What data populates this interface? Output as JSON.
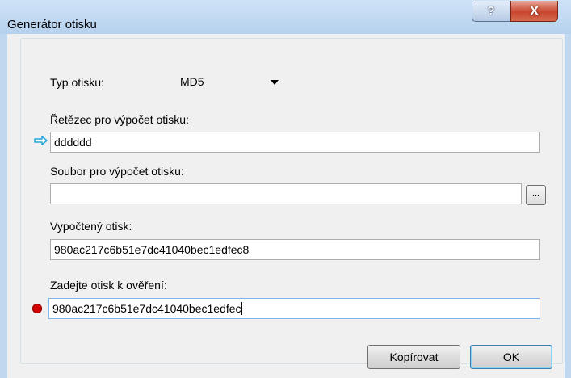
{
  "window": {
    "title": "Generátor otisku",
    "help_label": "?",
    "close_label": "X"
  },
  "form": {
    "hash_type_label": "Typ otisku:",
    "hash_type_value": "MD5",
    "string_label": "Řetězec pro výpočet otisku:",
    "string_value": "dddddd",
    "file_label": "Soubor pro výpočet otisku:",
    "file_value": "",
    "browse_label": "...",
    "computed_label": "Vypočtený otisk:",
    "computed_value": "980ac217c6b51e7dc41040bec1edfec8",
    "verify_label": "Zadejte otisk k ověření:",
    "verify_value": "980ac217c6b51e7dc41040bec1edfec"
  },
  "buttons": {
    "copy_label": "Kopírovat",
    "ok_label": "OK"
  },
  "colors": {
    "status_mismatch": "#d40000",
    "arrow_indicator": "#2aa7d8"
  },
  "icons": {
    "string_indicator": "arrow-right-icon",
    "verify_indicator": "mismatch-dot-icon"
  }
}
